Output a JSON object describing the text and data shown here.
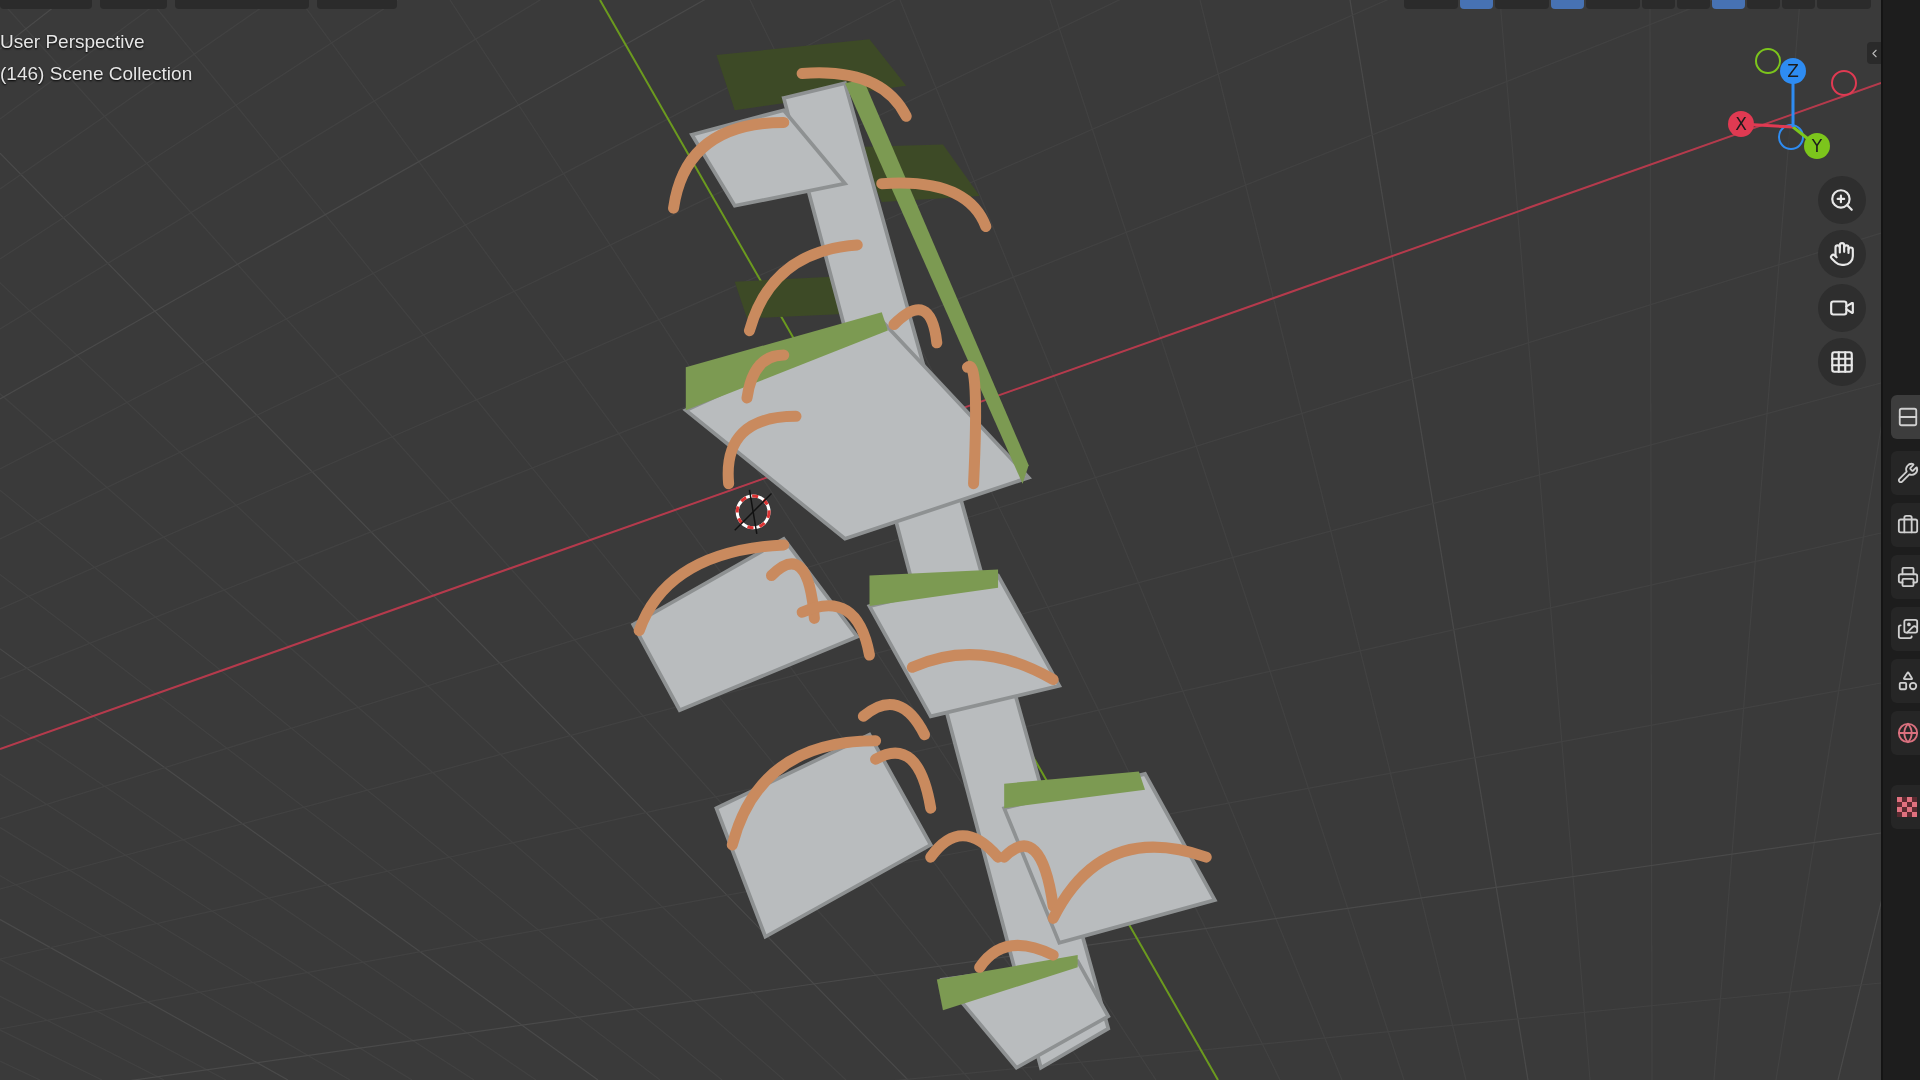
{
  "header": {
    "left_buttons": [
      {
        "selected": false
      },
      {
        "selected": false
      },
      {
        "selected": false
      },
      {
        "selected": false
      }
    ],
    "right_buttons": [
      {
        "kind": "dropdown",
        "selected": false
      },
      {
        "kind": "toggle",
        "selected": true
      },
      {
        "kind": "dropdown",
        "selected": false
      },
      {
        "kind": "toggle",
        "selected": true
      },
      {
        "kind": "dropdown",
        "selected": false
      },
      {
        "kind": "toggle",
        "selected": false
      },
      {
        "kind": "shading",
        "selected": false
      },
      {
        "kind": "shading",
        "selected": true
      },
      {
        "kind": "shading",
        "selected": false
      },
      {
        "kind": "shading",
        "selected": false
      },
      {
        "kind": "dropdown",
        "selected": false
      }
    ]
  },
  "viewport": {
    "view_name": "User Perspective",
    "collection": "(146) Scene Collection"
  },
  "gizmo": {
    "axes": [
      {
        "label": "X",
        "color": "#e03a52"
      },
      {
        "label": "Y",
        "color": "#7cc51c"
      },
      {
        "label": "Z",
        "color": "#2e8cf2"
      }
    ]
  },
  "nav_tools": [
    {
      "kind": "zoom"
    },
    {
      "kind": "pan"
    },
    {
      "kind": "camera"
    },
    {
      "kind": "ortho"
    }
  ],
  "properties_tabs": [
    {
      "kind": "tool",
      "selected": true
    },
    {
      "kind": "active_tool",
      "selected": false
    },
    {
      "kind": "render",
      "selected": false
    },
    {
      "kind": "output",
      "selected": false
    },
    {
      "kind": "view_layer",
      "selected": false
    },
    {
      "kind": "scene",
      "selected": false
    },
    {
      "kind": "world",
      "selected": false
    },
    {
      "kind": "texture",
      "selected": false
    }
  ]
}
